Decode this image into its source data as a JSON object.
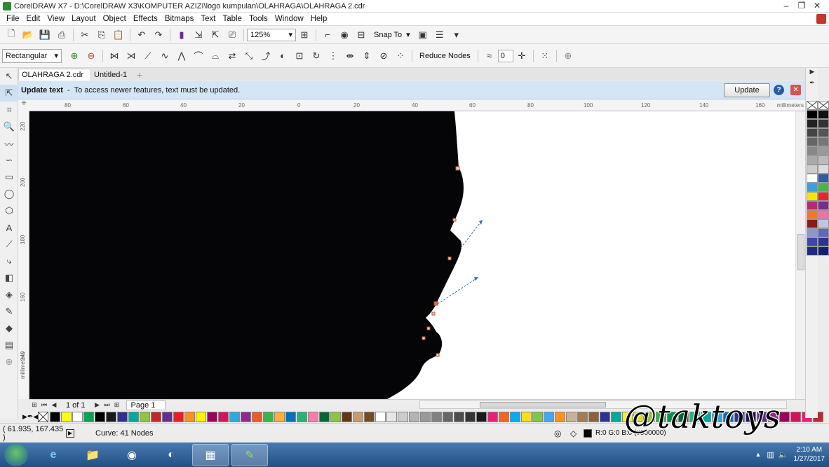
{
  "window": {
    "title": "CorelDRAW X7 - D:\\CorelDRAW X3\\KOMPUTER  AZIZI\\logo kumpulan\\OLAHRAGA\\OLAHRAGA 2.cdr"
  },
  "menu": [
    "File",
    "Edit",
    "View",
    "Layout",
    "Object",
    "Effects",
    "Bitmaps",
    "Text",
    "Table",
    "Tools",
    "Window",
    "Help"
  ],
  "toolbar": {
    "zoom": "125%",
    "snap_label": "Snap To"
  },
  "propertybar": {
    "shape_mode": "Rectangular",
    "reduce_nodes": "Reduce Nodes",
    "smoothness": "0"
  },
  "tabs": [
    "OLAHRAGA 2.cdr",
    "Untitled-1"
  ],
  "infobar": {
    "title": "Update text",
    "separator": "-",
    "message": "To access newer features, text must be updated.",
    "button": "Update"
  },
  "ruler": {
    "h_labels": [
      "80",
      "60",
      "40",
      "20",
      "0",
      "20",
      "40",
      "60",
      "80",
      "100",
      "120",
      "140",
      "160"
    ],
    "unit": "millimeters",
    "v_labels": [
      "220",
      "200",
      "180",
      "160",
      "140"
    ],
    "v_unit": "millimeters"
  },
  "pagebar": {
    "count": "1 of 1",
    "page_tab": "Page 1"
  },
  "status": {
    "coords": "( 61.935, 167.435 )",
    "selection": "Curve: 41 Nodes",
    "fill": "R:0 G:0 B:0 (#000000)"
  },
  "clock": {
    "time": "2:10 AM",
    "date": "1/27/2017"
  },
  "watermark": "@taktoys",
  "palette_colors": [
    "#000000",
    "#ffff00",
    "#ffffff",
    "#00a651",
    "#000000",
    "#1a1a1a",
    "#2e3192",
    "#00a99d",
    "#8dc63f",
    "#c1272d",
    "#662d91",
    "#ed1c24",
    "#f7931e",
    "#fff200",
    "#9e005d",
    "#d4145a",
    "#29abe2",
    "#93278f",
    "#f15a24",
    "#39b54a",
    "#fbb03b",
    "#0071bc",
    "#22b573",
    "#ff7bac",
    "#006837",
    "#8cc63f",
    "#603813",
    "#c69c6d",
    "#754c24",
    "#ffffff",
    "#e6e6e6",
    "#cccccc",
    "#b3b3b3",
    "#999999",
    "#808080",
    "#666666",
    "#4d4d4d",
    "#333333",
    "#1a1a1a",
    "#ed1e79",
    "#f26522",
    "#00aeef",
    "#ffde17",
    "#7ac943",
    "#3fa9f5",
    "#ff931e",
    "#c7b299",
    "#a67c52",
    "#8c6239",
    "#2e3192",
    "#00a99d",
    "#fcee21",
    "#d9e021",
    "#8dc63f",
    "#39b54a",
    "#009245",
    "#006837",
    "#22b573",
    "#00a99d",
    "#29abe2",
    "#0071bc",
    "#2e3192",
    "#1b1464",
    "#662d91",
    "#93278f",
    "#9e005d",
    "#d4145a",
    "#ed1e79",
    "#c1272d"
  ],
  "right_palette": [
    "#000000",
    "#111111",
    "#222222",
    "#333333",
    "#444444",
    "#555555",
    "#666666",
    "#777777",
    "#888888",
    "#999999",
    "#aaaaaa",
    "#bbbbbb",
    "#cccccc",
    "#dddddd",
    "#ffffff",
    "#2e5aa6",
    "#3b9fd9",
    "#48b648",
    "#f2e600",
    "#e8262a",
    "#b52a74",
    "#7b2d8e",
    "#f07b1e",
    "#e874a8",
    "#8c1a1a",
    "#bfc5e8",
    "#8e96d2",
    "#5d68b8",
    "#3d4aa0",
    "#2a3490",
    "#1f2880",
    "#161e70"
  ]
}
